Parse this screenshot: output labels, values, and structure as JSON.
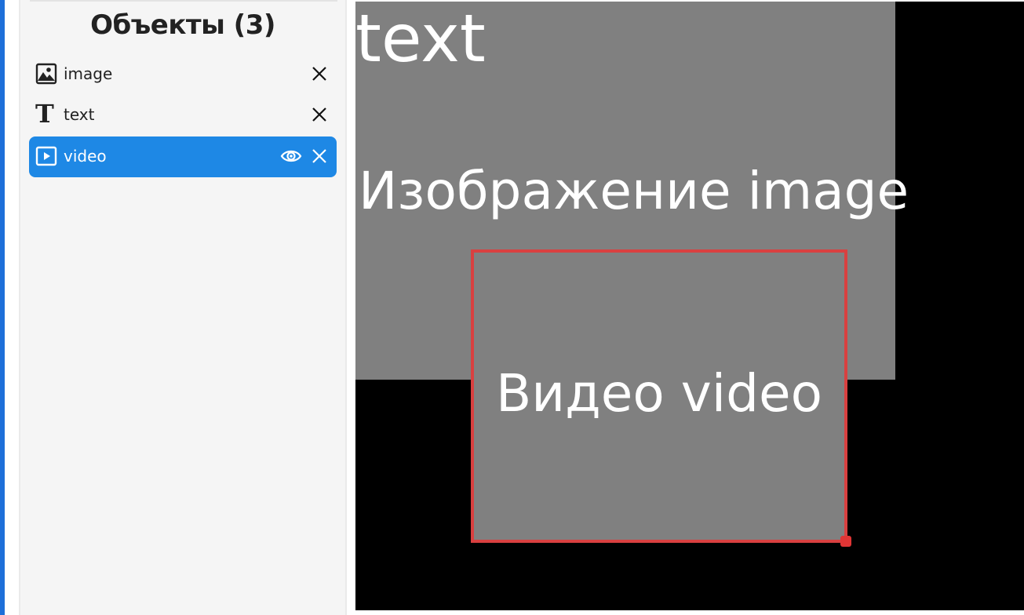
{
  "sidebar": {
    "title": "Объекты (3)",
    "items": [
      {
        "label": "image",
        "icon": "image-icon",
        "selected": false
      },
      {
        "label": "text",
        "icon": "text-T-icon",
        "icon_glyph": "T",
        "selected": false
      },
      {
        "label": "video",
        "icon": "video-icon",
        "selected": true
      }
    ]
  },
  "canvas": {
    "layers": {
      "text_label": "text",
      "image_label": "Изображение image",
      "video_label": "Видео video"
    }
  },
  "colors": {
    "accent_bar": "#1e6fd9",
    "selected_item": "#1e88e5",
    "layer_fill": "#808080",
    "selection_border": "#d94040",
    "canvas_bg": "#000000"
  }
}
